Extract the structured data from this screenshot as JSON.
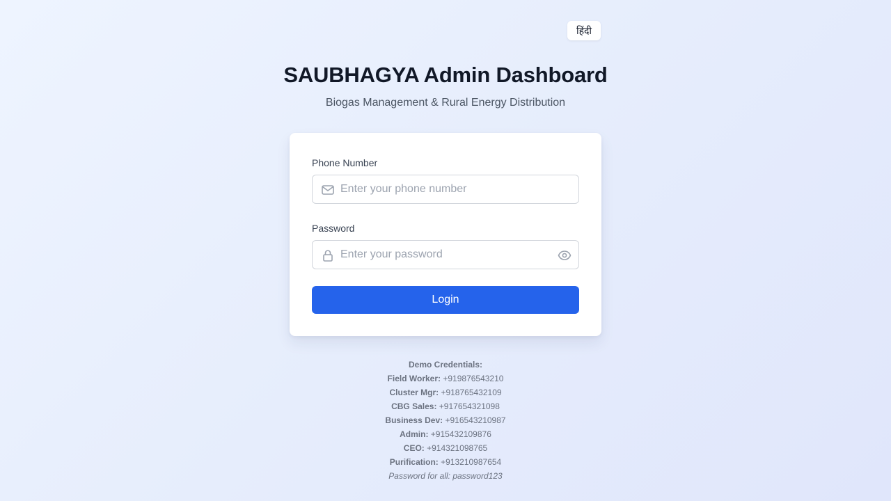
{
  "language_toggle": {
    "label": "हिंदी"
  },
  "header": {
    "title": "SAUBHAGYA Admin Dashboard",
    "subtitle": "Biogas Management & Rural Energy Distribution"
  },
  "form": {
    "phone": {
      "label": "Phone Number",
      "placeholder": "Enter your phone number",
      "value": "",
      "icon": "mail-icon"
    },
    "password": {
      "label": "Password",
      "placeholder": "Enter your password",
      "value": "",
      "icon": "lock-icon",
      "toggle_icon": "eye-icon"
    },
    "login_label": "Login"
  },
  "demo": {
    "heading": "Demo Credentials:",
    "accounts": [
      {
        "role": "Field Worker:",
        "phone": "+919876543210"
      },
      {
        "role": "Cluster Mgr:",
        "phone": "+918765432109"
      },
      {
        "role": "CBG Sales:",
        "phone": "+917654321098"
      },
      {
        "role": "Business Dev:",
        "phone": "+916543210987"
      },
      {
        "role": "Admin:",
        "phone": "+915432109876"
      },
      {
        "role": "CEO:",
        "phone": "+914321098765"
      },
      {
        "role": "Purification:",
        "phone": "+913210987654"
      }
    ],
    "password_note": "Password for all: password123"
  },
  "colors": {
    "accent": "#2563eb",
    "title": "#111827",
    "muted": "#6b7280"
  }
}
